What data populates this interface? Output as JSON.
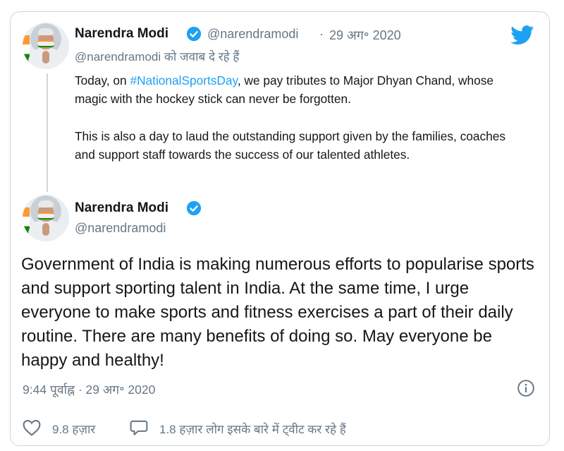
{
  "parent_tweet": {
    "author_name": "Narendra Modi",
    "handle": "@narendramodi",
    "separator": "·",
    "date": "29 अग॰ 2020",
    "replying_to": "@narendramodi को जवाब दे रहे हैं",
    "para1_before": "Today, on ",
    "hashtag": "#NationalSportsDay",
    "para1_after": ", we pay tributes to Major Dhyan Chand, whose magic with the hockey stick can never be forgotten.",
    "para2": "This is also a day to laud the outstanding support given by the families, coaches and support staff towards the success of our talented athletes."
  },
  "main_tweet": {
    "author_name": "Narendra Modi",
    "handle": "@narendramodi",
    "text": "Government of India is making numerous efforts to popularise sports and support sporting talent in India. At the same time, I urge everyone to make sports and fitness exercises a part of their daily routine. There are many benefits of doing so. May everyone be happy and healthy!",
    "timestamp": "9:44 पूर्वाह्न · 29 अग॰ 2020"
  },
  "actions": {
    "likes": "9.8 हज़ार",
    "talking": "1.8 हज़ार लोग इसके बारे में ट्वीट कर रहे हैं"
  },
  "colors": {
    "accent": "#1da1f2",
    "text": "#14171a",
    "muted": "#657786",
    "border": "#ccd6dd"
  },
  "icons": {
    "brand": "twitter-bird-icon",
    "verified": "verified-badge-icon",
    "info": "info-icon",
    "like": "heart-icon",
    "reply": "speech-bubble-icon"
  }
}
